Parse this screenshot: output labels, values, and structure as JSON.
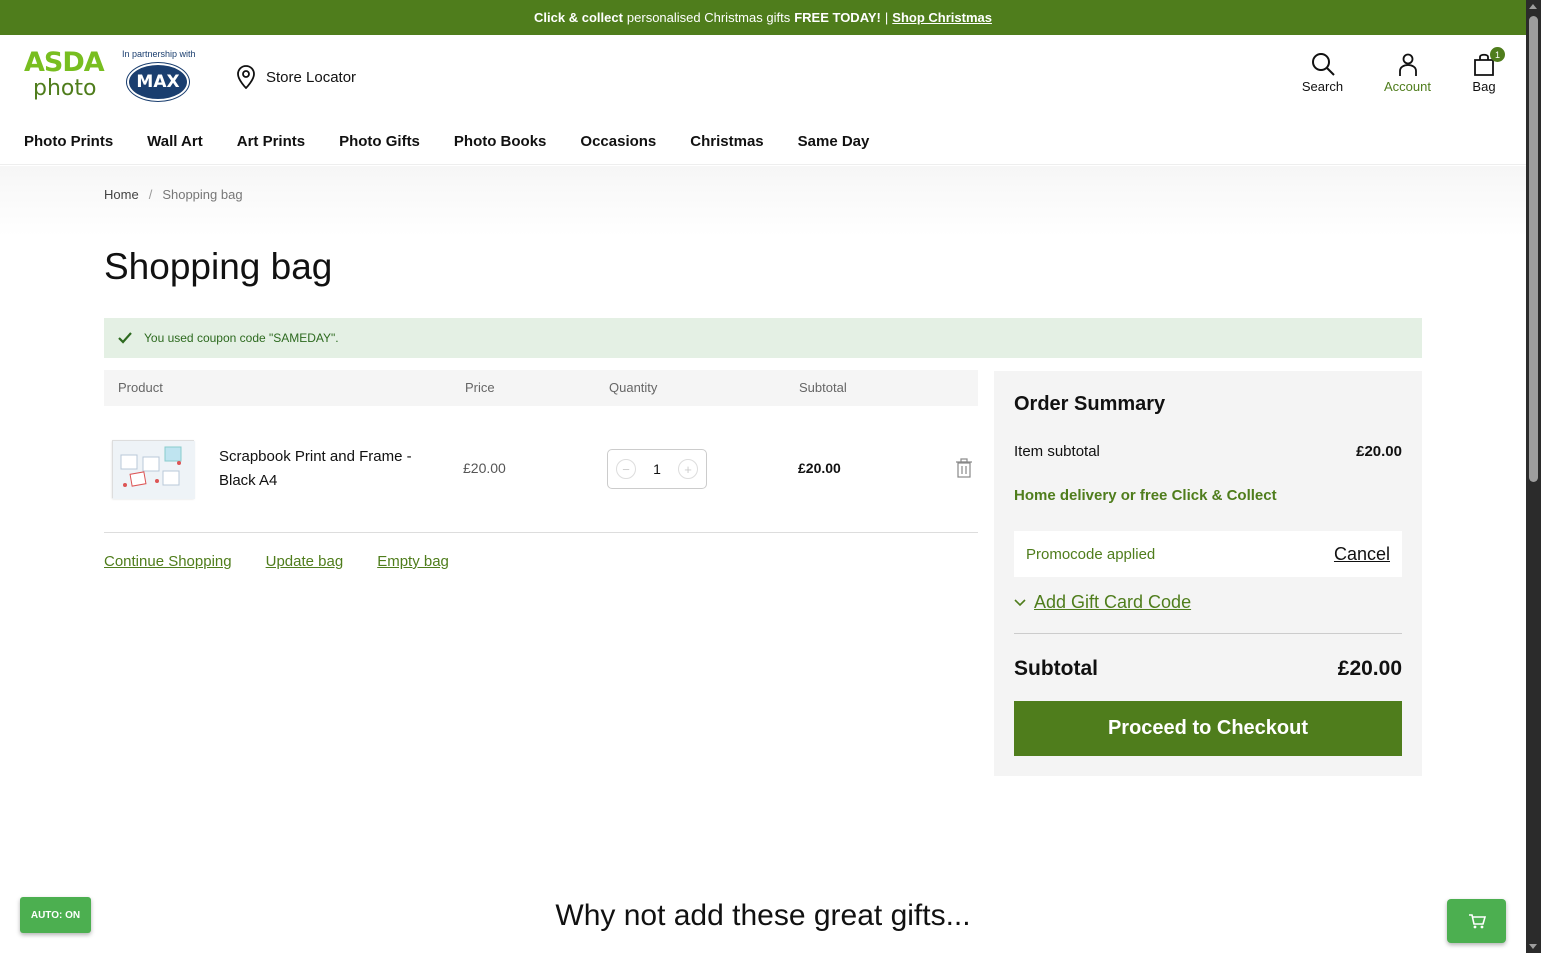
{
  "promo_bar": {
    "bold1": "Click & collect",
    "text": "personalised Christmas gifts",
    "bold2": "FREE TODAY!",
    "sep": "|",
    "link": "Shop Christmas"
  },
  "header": {
    "logo_top": "ASDA",
    "logo_bottom": "photo",
    "partner_text": "In partnership with",
    "partner_logo": "MAX",
    "store_locator": "Store Locator",
    "search_label": "Search",
    "account_label": "Account",
    "bag_label": "Bag",
    "bag_count": "1"
  },
  "nav": {
    "items": [
      "Photo Prints",
      "Wall Art",
      "Art Prints",
      "Photo Gifts",
      "Photo Books",
      "Occasions",
      "Christmas",
      "Same Day"
    ]
  },
  "breadcrumb": {
    "home": "Home",
    "sep": "/",
    "current": "Shopping bag"
  },
  "page_title": "Shopping bag",
  "success_message": "You used coupon code \"SAMEDAY\".",
  "table": {
    "headers": [
      "Product",
      "Price",
      "Quantity",
      "Subtotal"
    ],
    "rows": [
      {
        "name": "Scrapbook Print and Frame - Black A4",
        "price": "£20.00",
        "quantity": "1",
        "subtotal": "£20.00"
      }
    ]
  },
  "actions": {
    "continue": "Continue Shopping",
    "update": "Update bag",
    "empty": "Empty bag"
  },
  "summary": {
    "title": "Order Summary",
    "item_subtotal_label": "Item subtotal",
    "item_subtotal_value": "£20.00",
    "delivery": "Home delivery or free Click & Collect",
    "promocode_label": "Promocode applied",
    "cancel": "Cancel",
    "gift_card": "Add Gift Card Code",
    "subtotal_label": "Subtotal",
    "subtotal_value": "£20.00",
    "checkout": "Proceed to Checkout"
  },
  "gifts_title": "Why not add these great gifts...",
  "auto_button": "AUTO: ON",
  "colors": {
    "brand_green": "#4f7d1c",
    "logo_green": "#78be20",
    "success_bg": "#e4f0e4",
    "fab_green": "#4caf50"
  }
}
